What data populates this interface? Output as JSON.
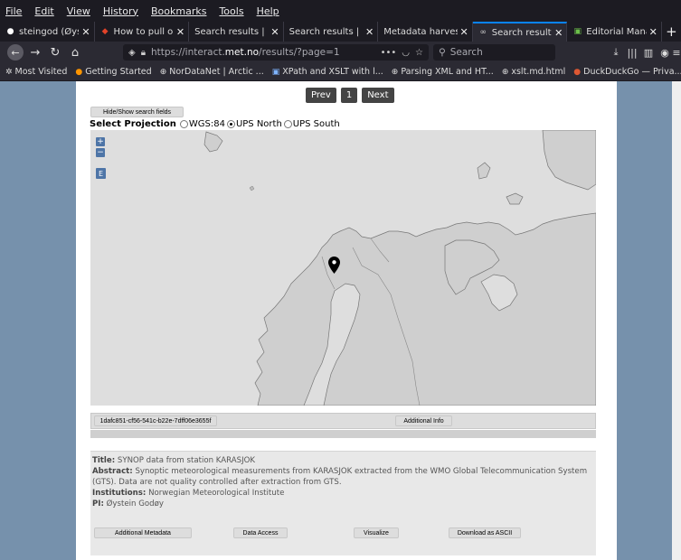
{
  "menu": [
    "File",
    "Edit",
    "View",
    "History",
    "Bookmarks",
    "Tools",
    "Help"
  ],
  "tabs": [
    {
      "label": "steingod (Øystein",
      "icon": "github-icon",
      "glyph": "●"
    },
    {
      "label": "How to pull one c",
      "icon": "gitlab-icon",
      "glyph": "◆"
    },
    {
      "label": "Search results | adc",
      "icon": "",
      "glyph": ""
    },
    {
      "label": "Search results | Nor",
      "icon": "",
      "glyph": ""
    },
    {
      "label": "Metadata harvests fo",
      "icon": "",
      "glyph": ""
    },
    {
      "label": "Search results |",
      "icon": "share-icon",
      "glyph": "∞"
    },
    {
      "label": "Editorial Manager",
      "icon": "editorial-icon",
      "glyph": "▣"
    }
  ],
  "url": {
    "prefix": "https://interact.",
    "domain": "met.no",
    "path": "/results/?page=1"
  },
  "search_placeholder": "Search",
  "bookmarks": [
    {
      "label": "Most Visited",
      "icon": "gear-icon",
      "glyph": "✲"
    },
    {
      "label": "Getting Started",
      "icon": "firefox-icon",
      "glyph": "●"
    },
    {
      "label": "NorDataNet | Arctic ...",
      "icon": "globe-icon",
      "glyph": "⊕"
    },
    {
      "label": "XPath and XSLT with l...",
      "icon": "image-icon",
      "glyph": "▣"
    },
    {
      "label": "Parsing XML and HT...",
      "icon": "globe-icon",
      "glyph": "⊕"
    },
    {
      "label": "xslt.md.html",
      "icon": "globe-icon",
      "glyph": "⊕"
    },
    {
      "label": "DuckDuckGo — Priva...",
      "icon": "duckduckgo-icon",
      "glyph": "●"
    }
  ],
  "pager": {
    "prev": "Prev",
    "page": "1",
    "next": "Next"
  },
  "hide_show": "Hide/Show search fields",
  "projection": {
    "label": "Select Projection",
    "options": [
      "WGS:84",
      "UPS North",
      "UPS South"
    ],
    "selected": "UPS North"
  },
  "map_controls": {
    "zoom_in": "+",
    "zoom_out": "−",
    "extent": "E"
  },
  "record": {
    "id": "1dafc851-cf56-541c-b22e-7dff06e3655f",
    "additional_info": "Additional Info",
    "title_label": "Title:",
    "title": "SYNOP data from station KARASJOK",
    "abstract_label": "Abstract:",
    "abstract": "Synoptic meteorological measurements from KARASJOK extracted from the WMO Global Telecommunication System (GTS). Data are not quality controlled after extraction from GTS.",
    "institutions_label": "Institutions:",
    "institutions": "Norwegian Meteorological Institute",
    "pi_label": "PI:",
    "pi": "Øystein Godøy"
  },
  "actions": [
    "Additional Metadata",
    "Data Access",
    "Visualize",
    "Download as ASCII"
  ],
  "colors": {
    "accent": "#0a84ff",
    "page_bg": "#7691ac",
    "map_land": "#cfcfcf",
    "map_sea": "#dedede"
  }
}
